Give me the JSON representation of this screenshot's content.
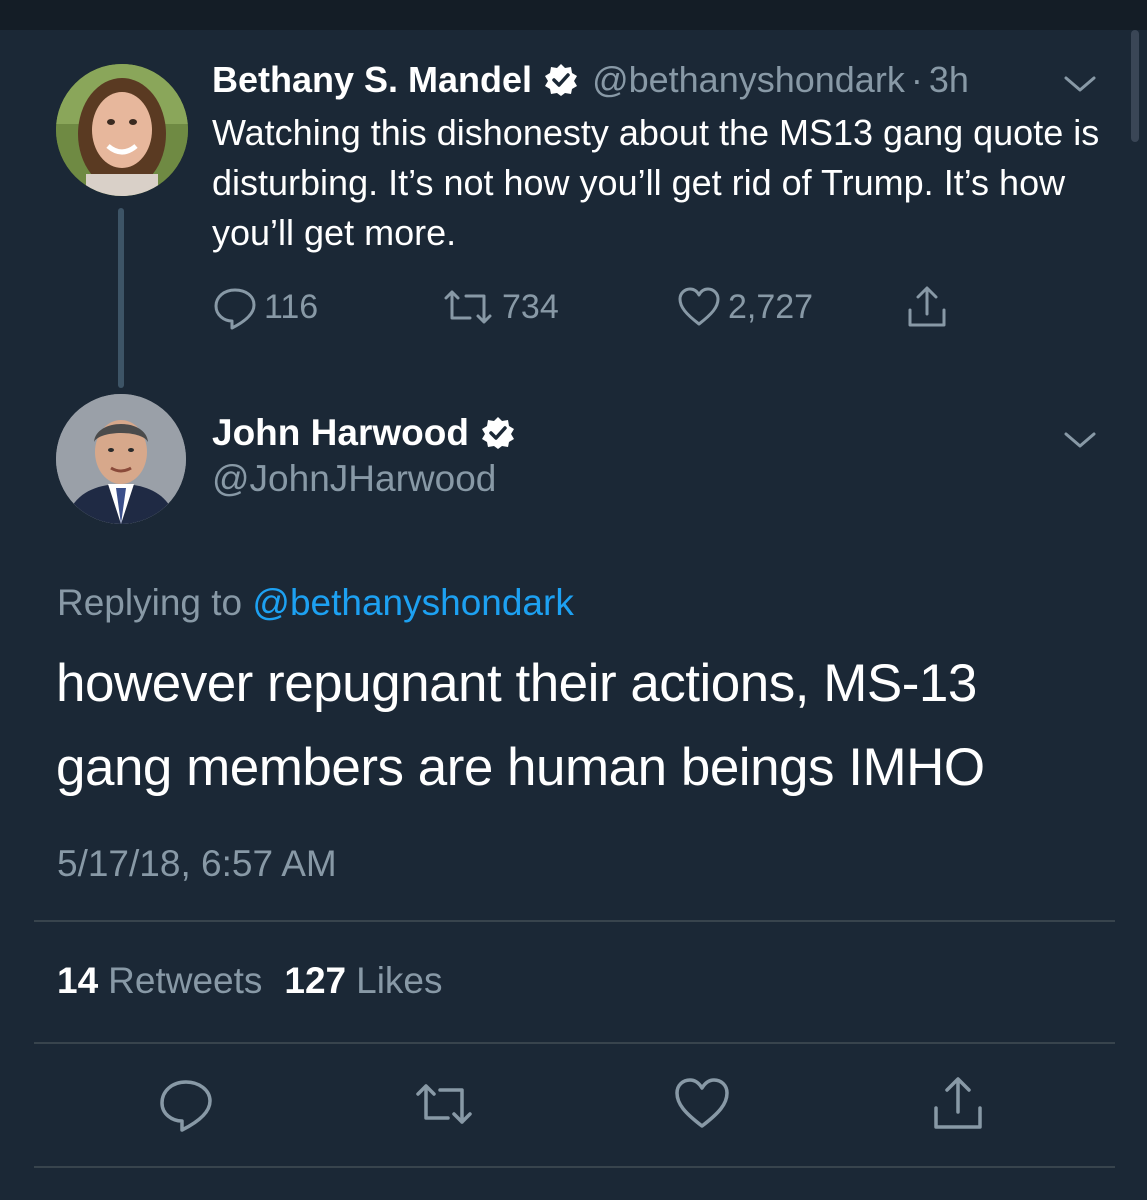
{
  "colors": {
    "background": "#1b2836",
    "secondary_text": "#8899a6",
    "link": "#1da1f2",
    "divider": "#38444d"
  },
  "parent_tweet": {
    "name": "Bethany S. Mandel",
    "handle": "@bethanyshondark",
    "separator": "·",
    "time": "3h",
    "text": "Watching this dishonesty about the MS13 gang quote is disturbing. It’s not how you’ll get rid of Trump. It’s how you’ll get more.",
    "replies": "116",
    "retweets": "734",
    "likes": "2,727",
    "icons": [
      "reply-icon",
      "retweet-icon",
      "like-icon",
      "share-icon",
      "verified-badge-icon",
      "chevron-down-icon"
    ]
  },
  "main_tweet": {
    "name": "John Harwood",
    "handle": "@JohnJHarwood",
    "replying_prefix": "Replying to",
    "replying_mention": "@bethanyshondark",
    "text": "however repugnant their actions, MS-13 gang members are human beings IMHO",
    "timestamp": "5/17/18, 6:57 AM",
    "retweet_count": "14",
    "retweet_label": "Retweets",
    "like_count": "127",
    "like_label": "Likes",
    "icons": [
      "reply-icon",
      "retweet-icon",
      "like-icon",
      "share-icon"
    ]
  }
}
